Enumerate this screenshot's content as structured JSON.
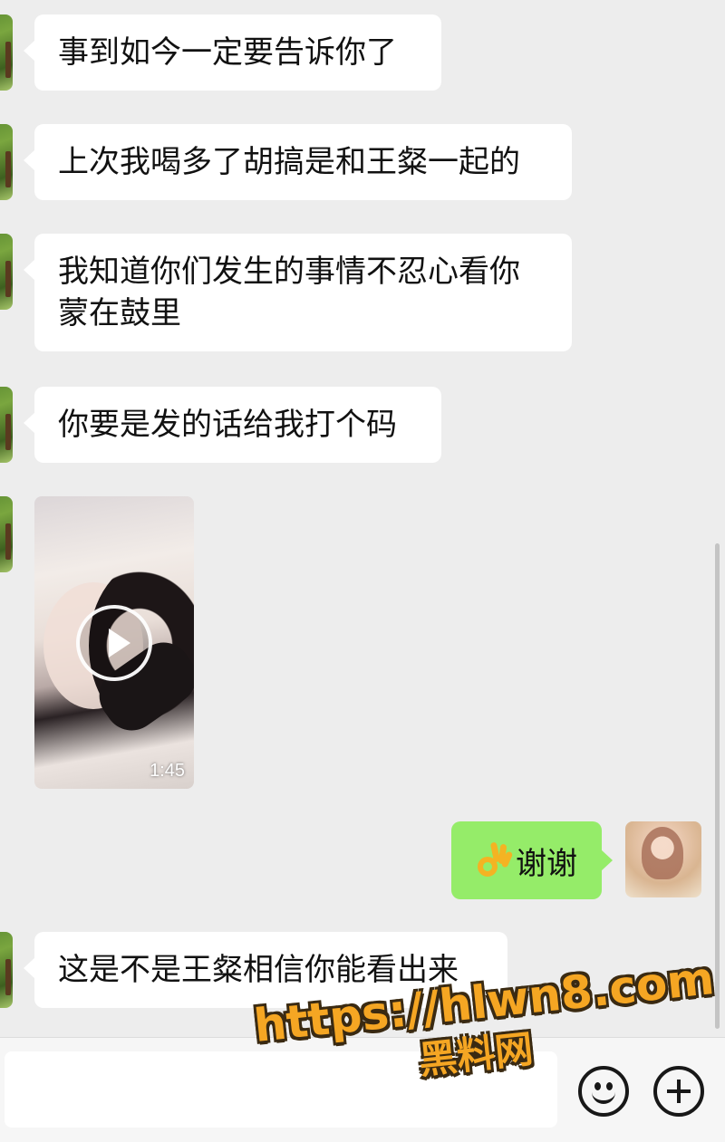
{
  "messages": [
    {
      "side": "left",
      "type": "text",
      "text": "事到如今一定要告诉你了"
    },
    {
      "side": "left",
      "type": "text",
      "text": "上次我喝多了胡搞是和王粲一起的"
    },
    {
      "side": "left",
      "type": "text",
      "lines": [
        "我知道你们发生的事情不忍心看你",
        "蒙在鼓里"
      ]
    },
    {
      "side": "left",
      "type": "text",
      "text": "你要是发的话给我打个码"
    },
    {
      "side": "left",
      "type": "video",
      "duration": "1:45",
      "icon": "play-icon"
    },
    {
      "side": "right",
      "type": "text",
      "emoji": "ok-hand-emoji",
      "text": "谢谢"
    },
    {
      "side": "left",
      "type": "text",
      "text": "这是不是王粲相信你能看出来"
    }
  ],
  "input_bar": {
    "placeholder": "",
    "emoji_icon": "smiley-face-icon",
    "more_icon": "plus-circle-icon"
  },
  "watermark": {
    "url": "https://hlwn8.com",
    "name": "黑料网"
  },
  "colors": {
    "background": "#ededed",
    "incoming_bubble": "#ffffff",
    "outgoing_bubble": "#95ec69",
    "watermark": "#f5a623"
  }
}
